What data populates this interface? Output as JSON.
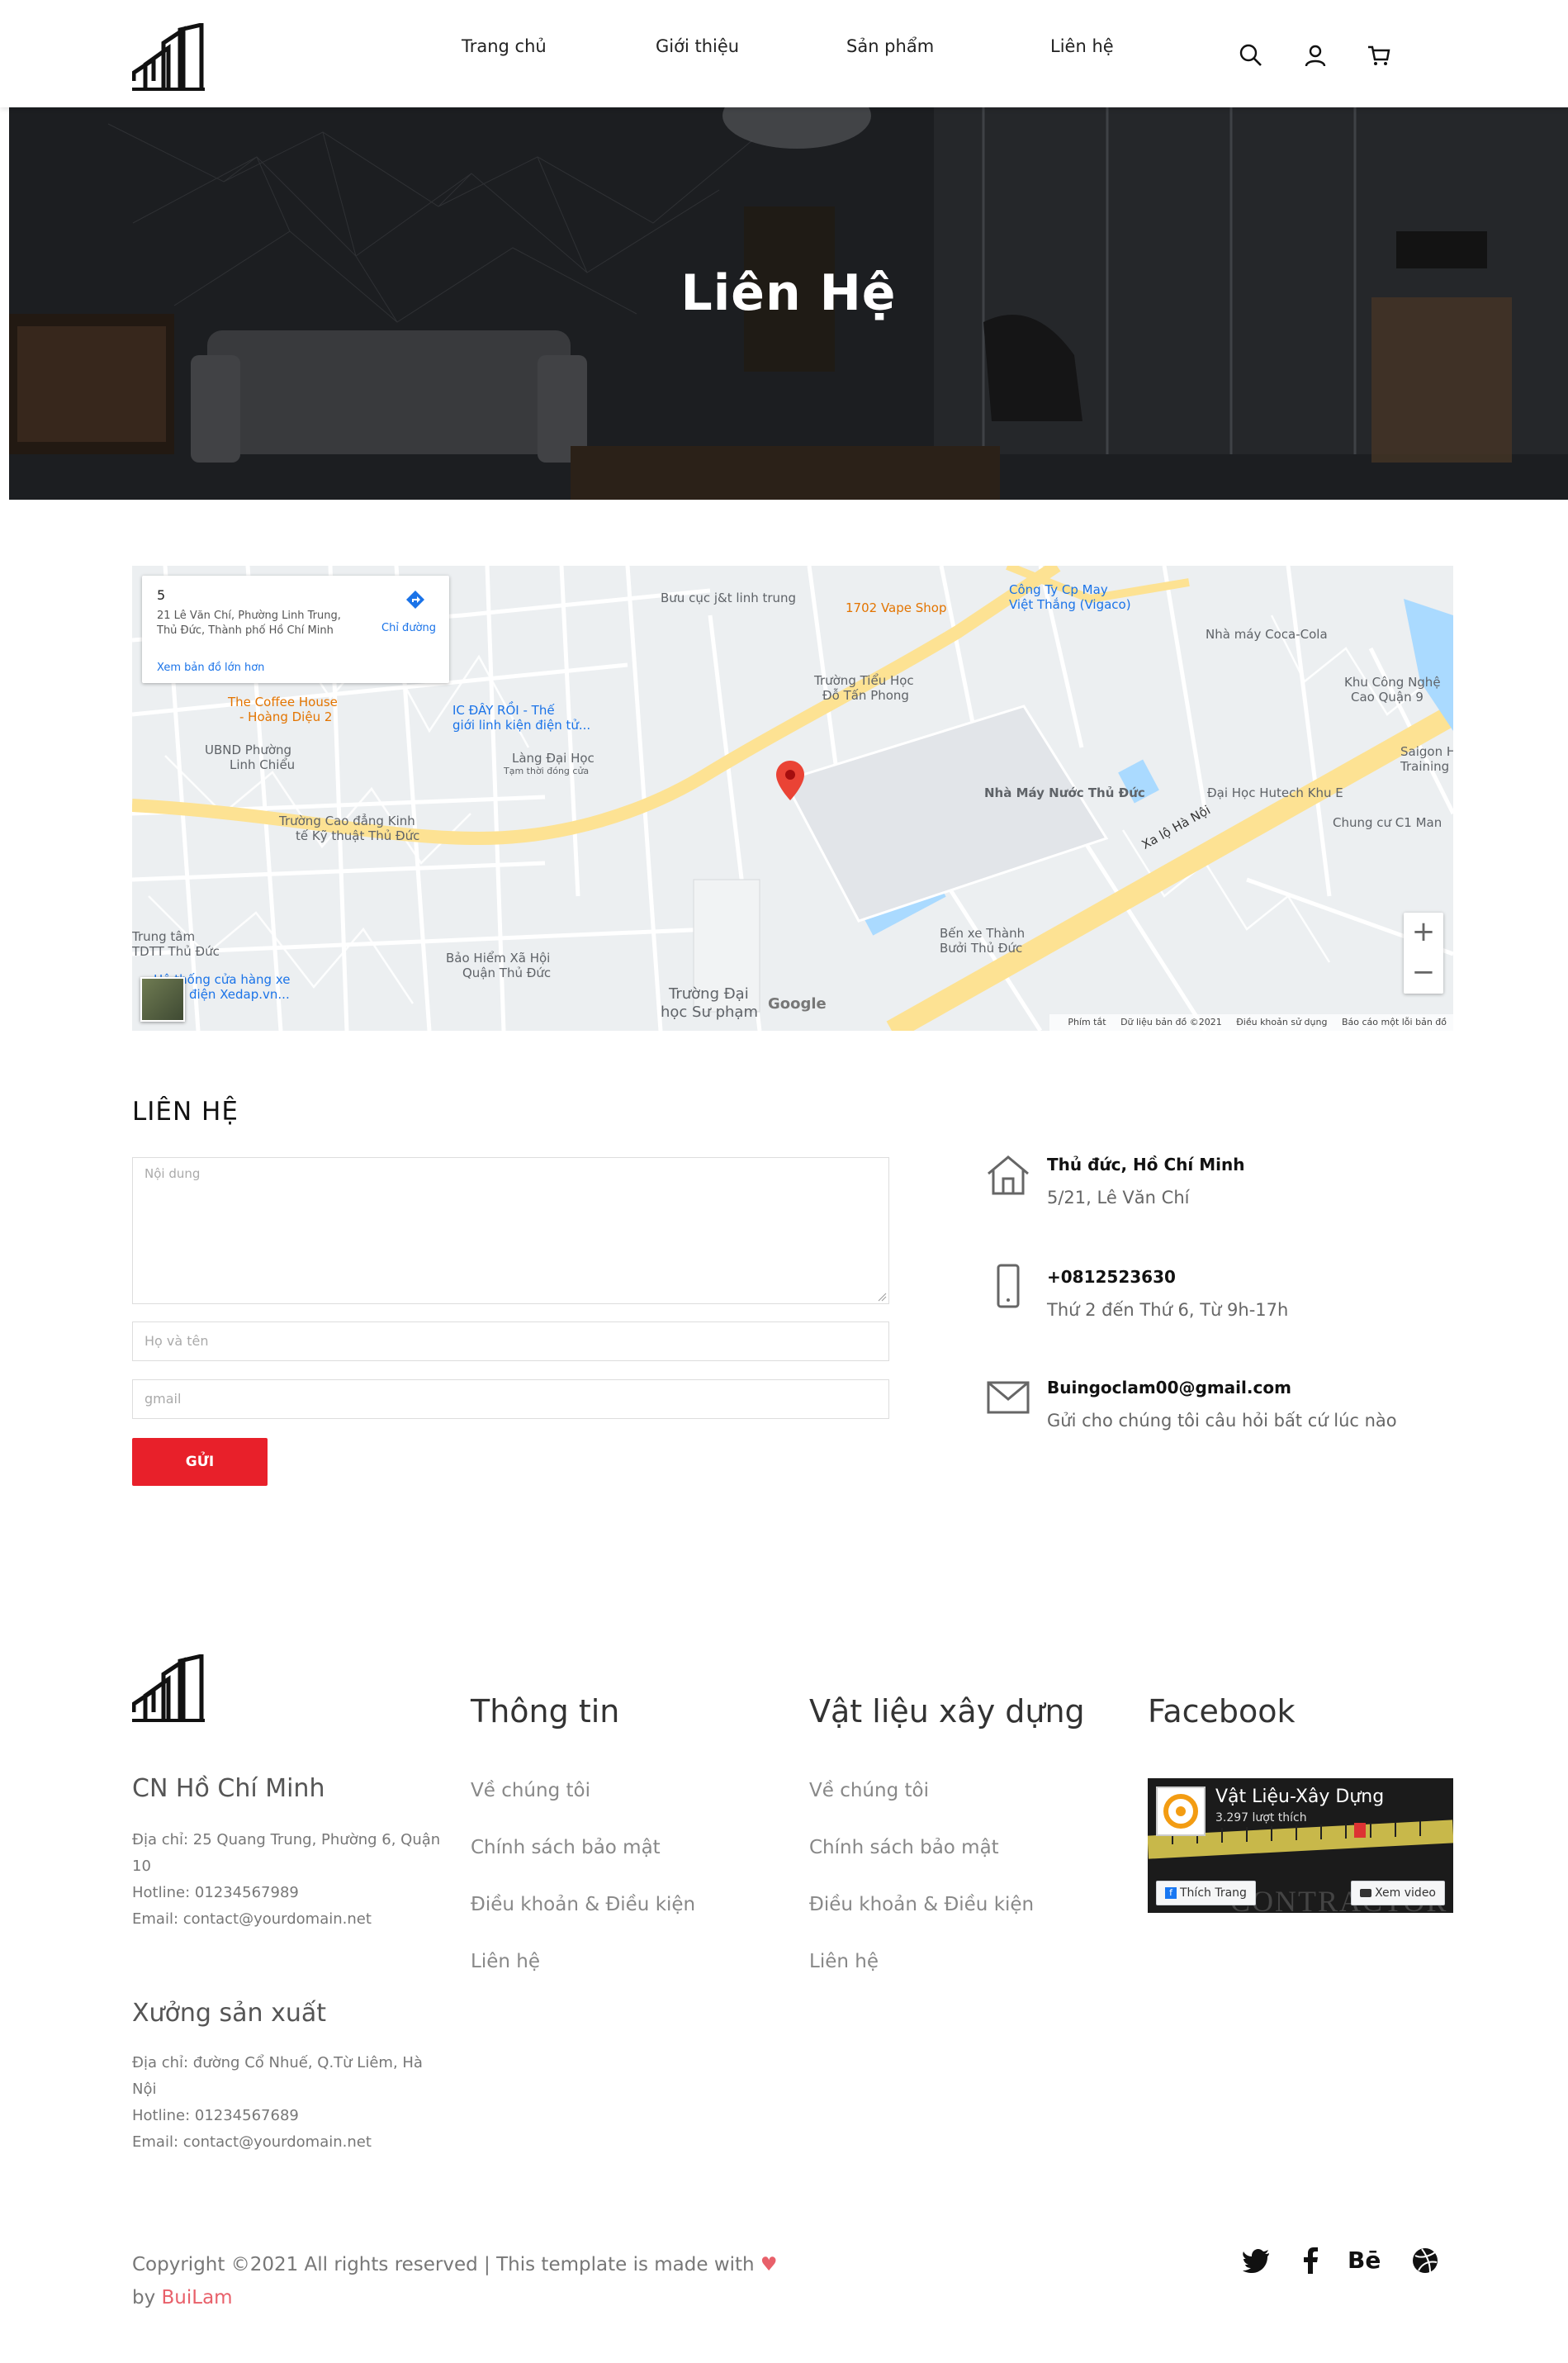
{
  "header": {
    "nav": [
      "Trang chủ",
      "Giới thiệu",
      "Sản phẩm",
      "Liên hệ"
    ],
    "icons": [
      "search-icon",
      "user-icon",
      "cart-icon"
    ]
  },
  "hero": {
    "title": "Liên Hệ"
  },
  "map": {
    "card": {
      "number": "5",
      "address": "21 Lê Văn Chí, Phường Linh Trung, Thủ Đức, Thành phố Hồ Chí Minh",
      "directions": "Chỉ đường",
      "view_larger": "Xem bản đồ lớn hơn"
    },
    "labels": {
      "buu_cuc": "Bưu cục j&t linh trung",
      "vape": "1702 Vape Shop",
      "vigaco_1": "Công Ty Cp May",
      "vigaco_2": "Việt Thắng (Vigaco)",
      "coca": "Nhà máy Coca-Cola",
      "khu_cong_nghe_1": "Khu Công Nghệ",
      "khu_cong_nghe_2": "Cao Quận 9",
      "coffee_1": "The Coffee House",
      "coffee_2": "- Hoàng Diệu 2",
      "ic_1": "IC ĐÂY RỒI - Thế",
      "ic_2": "giới linh kiện điện tử...",
      "ubnd_1": "UBND Phường",
      "ubnd_2": "Linh Chiểu",
      "lang_dh": "Làng Đại Học",
      "tam_thoi": "Tạm thời đóng cửa",
      "tieu_hoc_1": "Trường Tiểu Học",
      "tieu_hoc_2": "Đỗ Tấn Phong",
      "nuoc": "Nhà Máy Nước Thủ Đức",
      "hutech": "Đại Học Hutech Khu E",
      "saigon_1": "Saigon H",
      "saigon_2": "Training",
      "chung_cu": "Chung cư C1 Man",
      "cd_kinh_te_1": "Trường Cao đẳng Kinh",
      "cd_kinh_te_2": "tế Kỹ thuật Thủ Đức",
      "xa_lo": "Xa lộ Hà Nội",
      "tdtt_1": "Trung tâm",
      "tdtt_2": "TDTT Thủ Đức",
      "bao_hiem_1": "Bảo Hiểm Xã Hội",
      "bao_hiem_2": "Quận Thủ Đức",
      "su_pham_1": "Trường Đại",
      "su_pham_2": "học Sư phạm",
      "ben_xe_1": "Bến xe Thành",
      "ben_xe_2": "Bưởi Thủ Đức",
      "xedap_1": "Hệ thống cửa hàng xe",
      "xedap_2": "đạp điện Xedap.vn..."
    },
    "google": "Google",
    "footer": [
      "Phím tắt",
      "Dữ liệu bản đồ ©2021",
      "Điều khoản sử dụng",
      "Báo cáo một lỗi bản đồ"
    ],
    "zoom_in": "+",
    "zoom_out": "−"
  },
  "contact": {
    "title": "LIÊN HỆ",
    "content_placeholder": "Nội dung",
    "name_placeholder": "Họ và tên",
    "email_placeholder": "gmail",
    "send": "GỬI",
    "info": [
      {
        "icon": "home-icon",
        "title": "Thủ đức, Hồ Chí Minh",
        "sub": "5/21, Lê Văn Chí"
      },
      {
        "icon": "phone-icon",
        "title": "+0812523630",
        "sub": "Thứ 2 đến Thứ 6, Từ 9h-17h"
      },
      {
        "icon": "mail-icon",
        "title": "Buingoclam00@gmail.com",
        "sub": "Gửi cho chúng tôi câu hỏi bất cứ lúc nào"
      }
    ]
  },
  "footer": {
    "branch1": {
      "title": "CN Hồ Chí Minh",
      "address": "Địa chỉ: 25 Quang Trung, Phường 6, Quận 10",
      "hotline": "Hotline: 01234567989",
      "email": "Email: contact@yourdomain.net"
    },
    "branch2": {
      "title": "Xưởng sản xuất",
      "address": "Địa chỉ: đường Cổ Nhuế, Q.Từ Liêm, Hà Nội",
      "hotline": "Hotline: 01234567689",
      "email": "Email: contact@yourdomain.net"
    },
    "col_info": {
      "title": "Thông tin",
      "links": [
        "Về chúng tôi",
        "Chính sách bảo mật",
        "Điều khoản & Điều kiện",
        "Liên hệ"
      ]
    },
    "col_materials": {
      "title": "Vật liệu xây dựng",
      "links": [
        "Về chúng tôi",
        "Chính sách bảo mật",
        "Điều khoản & Điều kiện",
        "Liên hệ"
      ]
    },
    "col_facebook": {
      "title": "Facebook"
    },
    "fb_widget": {
      "page_name": "Vật Liệu-Xây Dựng",
      "likes": "3.297 lượt thích",
      "like_btn": "Thích Trang",
      "video_btn": "Xem video",
      "bg_text": "CONTRACTOR"
    },
    "copyright_text": "Copyright ©2021 All rights reserved | This template is made with",
    "heart": "♥",
    "by": "by",
    "author": "BuiLam",
    "social": [
      "twitter-icon",
      "facebook-icon",
      "behance-icon",
      "dribbble-icon"
    ],
    "behance_text": "Bē"
  },
  "colors": {
    "accent": "#e8202a",
    "heart": "#e8606a",
    "map_pin": "#ea4335",
    "map_link": "#1a73e8"
  }
}
